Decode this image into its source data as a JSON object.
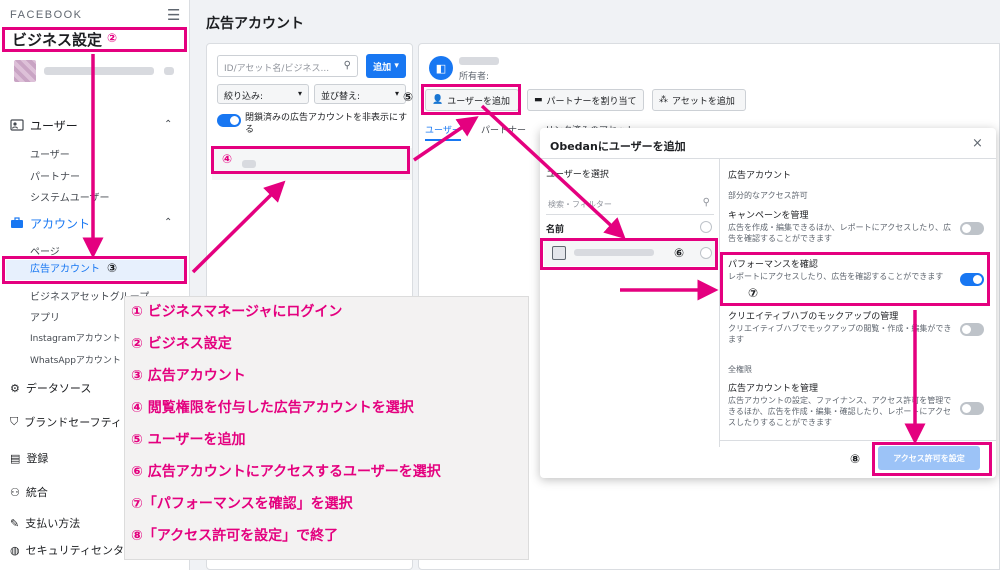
{
  "sidebar": {
    "brand": "FACEBOOK",
    "hamburger_icon": "☰",
    "title": "ビジネス設定",
    "sections": [
      {
        "label": "ユーザー",
        "icon": "user-id-icon",
        "items": [
          "ユーザー",
          "パートナー",
          "システムユーザー"
        ]
      },
      {
        "label": "アカウント",
        "icon": "briefcase-icon",
        "items": [
          "ページ",
          "広告アカウント",
          "ビジネスアセットグループ",
          "アプリ",
          "Instagramアカウント",
          "WhatsAppアカウント"
        ]
      }
    ],
    "bottom_items": [
      "データソース",
      "ブランドセーフティ",
      "登録",
      "統合",
      "支払い方法",
      "セキュリティセンター"
    ]
  },
  "main": {
    "title": "広告アカウント",
    "search_placeholder": "ID/アセット名/ビジネス...",
    "add_button": "追加",
    "filter_label": "絞り込み:",
    "sort_label": "並び替え:",
    "hide_closed_label": "閉鎖済みの広告アカウントを非表示にする",
    "owner_label": "所有者:",
    "actions": [
      "ユーザーを追加",
      "パートナーを割り当て",
      "アセットを追加"
    ],
    "tabs": [
      "ユーザー",
      "パートナー",
      "リンク済みのアセット"
    ]
  },
  "dialog": {
    "title": "Obedanにユーザーを追加",
    "close": "×",
    "left_heading": "ユーザーを選択",
    "filter_placeholder": "検索・フィルター",
    "name_heading": "名前",
    "right_heading": "広告アカウント",
    "partial_group": "部分的なアクセス許可",
    "permissions": [
      {
        "title": "キャンペーンを管理",
        "desc": "広告を作成・編集できるほか、レポートにアクセスしたり、広告を確認することができます",
        "enabled": false
      },
      {
        "title": "パフォーマンスを確認",
        "desc": "レポートにアクセスしたり、広告を確認することができます",
        "enabled": true
      },
      {
        "title": "クリエイティブハブのモックアップの管理",
        "desc": "クリエイティブハブでモックアップの閲覧・作成・編集ができます",
        "enabled": false
      }
    ],
    "full_group": "全権限",
    "full_permission": {
      "title": "広告アカウントを管理",
      "desc": "広告アカウントの設定、ファイナンス、アクセス許可を管理できるほか、広告を作成・編集・確認したり、レポートにアクセスしたりすることができます",
      "enabled": false
    },
    "grant_button": "アクセス許可を設定"
  },
  "annotations": {
    "markers": [
      "②",
      "③",
      "④",
      "⑤",
      "⑥",
      "⑦",
      "⑧"
    ],
    "accent_color": "#e4007f"
  },
  "steps": [
    "① ビジネスマネージャにログイン",
    "② ビジネス設定",
    "③ 広告アカウント",
    "④ 閲覧権限を付与した広告アカウントを選択",
    "⑤ ユーザーを追加",
    "⑥ 広告アカウントにアクセスするユーザーを選択",
    "⑦「パフォーマンスを確認」を選択",
    "⑧「アクセス許可を設定」で終了"
  ]
}
